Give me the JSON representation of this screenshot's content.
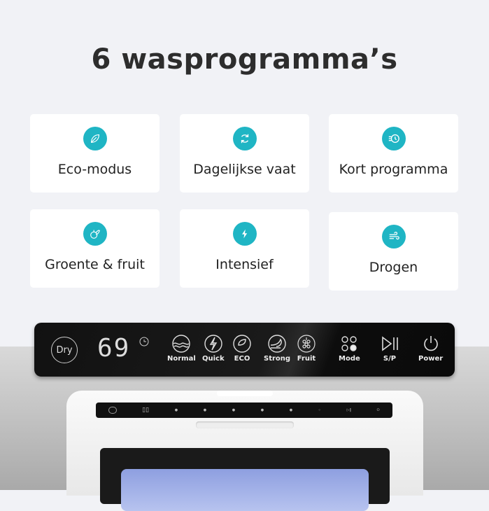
{
  "title": "6 wasprogramma’s",
  "accent_color": "#1fb5c4",
  "programs": [
    {
      "label": "Eco-modus",
      "icon": "leaf-icon"
    },
    {
      "label": "Dagelijkse vaat",
      "icon": "refresh-icon"
    },
    {
      "label": "Kort programma",
      "icon": "fast-clock-icon"
    },
    {
      "label": "Groente & fruit",
      "icon": "fruit-icon"
    },
    {
      "label": "Intensief",
      "icon": "lightning-icon"
    },
    {
      "label": "Drogen",
      "icon": "wind-icon"
    }
  ],
  "control_panel": {
    "dry": "Dry",
    "display": "69",
    "buttons": [
      {
        "label": "Normal",
        "icon": "waves-icon"
      },
      {
        "label": "Quick",
        "icon": "lightning-icon"
      },
      {
        "label": "ECO",
        "icon": "eco-leaf-icon"
      },
      {
        "label": "Strong",
        "icon": "strong-wave-icon"
      },
      {
        "label": "Fruit",
        "icon": "grapes-icon"
      },
      {
        "label": "Mode",
        "icon": "mode-dots-icon"
      },
      {
        "label": "S/P",
        "icon": "play-pause-icon"
      },
      {
        "label": "Power",
        "icon": "power-icon"
      }
    ]
  }
}
